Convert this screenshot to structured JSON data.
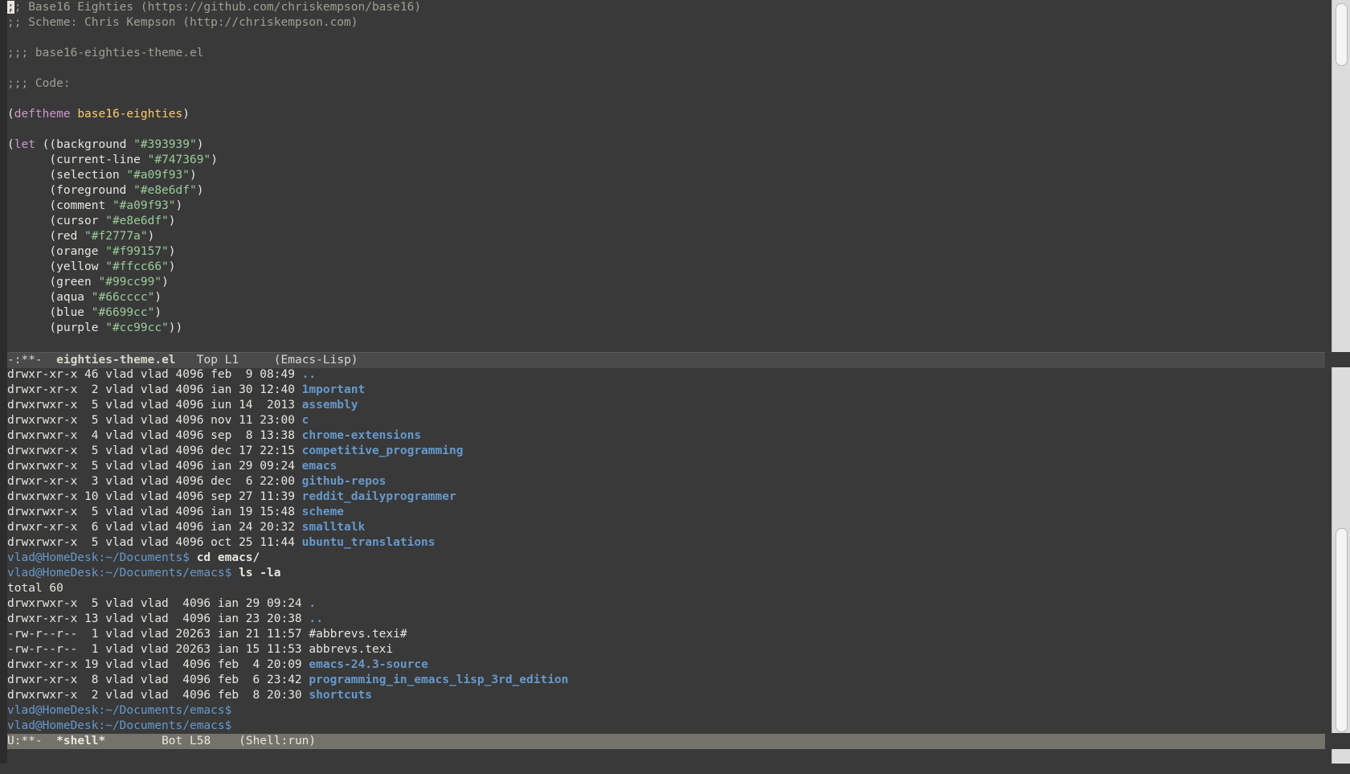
{
  "editor": {
    "lines": [
      [
        {
          "t": ";",
          "c": "cursor-block"
        },
        {
          "t": "; Base16 Eighties (https://github.com/chriskempson/base16)",
          "c": "cmt"
        }
      ],
      [
        {
          "t": ";; Scheme: Chris Kempson (http://chriskempson.com)",
          "c": "cmt"
        }
      ],
      [],
      [
        {
          "t": ";;; base16-eighties-theme.el",
          "c": "cmt"
        }
      ],
      [],
      [
        {
          "t": ";;; Code:",
          "c": "cmt"
        }
      ],
      [],
      [
        {
          "t": "(",
          "c": ""
        },
        {
          "t": "deftheme",
          "c": "kw"
        },
        {
          "t": " ",
          "c": ""
        },
        {
          "t": "base16-eighties",
          "c": "fn"
        },
        {
          "t": ")",
          "c": ""
        }
      ],
      [],
      [
        {
          "t": "(",
          "c": ""
        },
        {
          "t": "let",
          "c": "kw"
        },
        {
          "t": " ((background ",
          "c": ""
        },
        {
          "t": "\"#393939\"",
          "c": "str"
        },
        {
          "t": ")",
          "c": ""
        }
      ],
      [
        {
          "t": "      (current-line ",
          "c": ""
        },
        {
          "t": "\"#747369\"",
          "c": "str"
        },
        {
          "t": ")",
          "c": ""
        }
      ],
      [
        {
          "t": "      (selection ",
          "c": ""
        },
        {
          "t": "\"#a09f93\"",
          "c": "str"
        },
        {
          "t": ")",
          "c": ""
        }
      ],
      [
        {
          "t": "      (foreground ",
          "c": ""
        },
        {
          "t": "\"#e8e6df\"",
          "c": "str"
        },
        {
          "t": ")",
          "c": ""
        }
      ],
      [
        {
          "t": "      (comment ",
          "c": ""
        },
        {
          "t": "\"#a09f93\"",
          "c": "str"
        },
        {
          "t": ")",
          "c": ""
        }
      ],
      [
        {
          "t": "      (cursor ",
          "c": ""
        },
        {
          "t": "\"#e8e6df\"",
          "c": "str"
        },
        {
          "t": ")",
          "c": ""
        }
      ],
      [
        {
          "t": "      (red ",
          "c": ""
        },
        {
          "t": "\"#f2777a\"",
          "c": "str"
        },
        {
          "t": ")",
          "c": ""
        }
      ],
      [
        {
          "t": "      (orange ",
          "c": ""
        },
        {
          "t": "\"#f99157\"",
          "c": "str"
        },
        {
          "t": ")",
          "c": ""
        }
      ],
      [
        {
          "t": "      (yellow ",
          "c": ""
        },
        {
          "t": "\"#ffcc66\"",
          "c": "str"
        },
        {
          "t": ")",
          "c": ""
        }
      ],
      [
        {
          "t": "      (green ",
          "c": ""
        },
        {
          "t": "\"#99cc99\"",
          "c": "str"
        },
        {
          "t": ")",
          "c": ""
        }
      ],
      [
        {
          "t": "      (aqua ",
          "c": ""
        },
        {
          "t": "\"#66cccc\"",
          "c": "str"
        },
        {
          "t": ")",
          "c": ""
        }
      ],
      [
        {
          "t": "      (blue ",
          "c": ""
        },
        {
          "t": "\"#6699cc\"",
          "c": "str"
        },
        {
          "t": ")",
          "c": ""
        }
      ],
      [
        {
          "t": "      (purple ",
          "c": ""
        },
        {
          "t": "\"#cc99cc\"",
          "c": "str"
        },
        {
          "t": "))",
          "c": ""
        }
      ]
    ]
  },
  "modeline_top": {
    "state": "-:**-",
    "buffer": "eighties-theme.el",
    "position": "Top L1",
    "mode": "(Emacs-Lisp)"
  },
  "shell": {
    "lines": [
      [
        {
          "t": "drwxr-xr-x 46 vlad vlad 4096 feb  9 08:49 ",
          "c": ""
        },
        {
          "t": "..",
          "c": "dir"
        }
      ],
      [
        {
          "t": "drwxr-xr-x  2 vlad vlad 4096 ian 30 12:40 ",
          "c": ""
        },
        {
          "t": "1mportant",
          "c": "dir"
        }
      ],
      [
        {
          "t": "drwxrwxr-x  5 vlad vlad 4096 iun 14  2013 ",
          "c": ""
        },
        {
          "t": "assembly",
          "c": "dir"
        }
      ],
      [
        {
          "t": "drwxrwxr-x  5 vlad vlad 4096 nov 11 23:00 ",
          "c": ""
        },
        {
          "t": "c",
          "c": "dir"
        }
      ],
      [
        {
          "t": "drwxrwxr-x  4 vlad vlad 4096 sep  8 13:38 ",
          "c": ""
        },
        {
          "t": "chrome-extensions",
          "c": "dir"
        }
      ],
      [
        {
          "t": "drwxrwxr-x  5 vlad vlad 4096 dec 17 22:15 ",
          "c": ""
        },
        {
          "t": "competitive_programming",
          "c": "dir"
        }
      ],
      [
        {
          "t": "drwxrwxr-x  5 vlad vlad 4096 ian 29 09:24 ",
          "c": ""
        },
        {
          "t": "emacs",
          "c": "dir"
        }
      ],
      [
        {
          "t": "drwxr-xr-x  3 vlad vlad 4096 dec  6 22:00 ",
          "c": ""
        },
        {
          "t": "github-repos",
          "c": "dir"
        }
      ],
      [
        {
          "t": "drwxrwxr-x 10 vlad vlad 4096 sep 27 11:39 ",
          "c": ""
        },
        {
          "t": "reddit_dailyprogrammer",
          "c": "dir"
        }
      ],
      [
        {
          "t": "drwxrwxr-x  5 vlad vlad 4096 ian 19 15:48 ",
          "c": ""
        },
        {
          "t": "scheme",
          "c": "dir"
        }
      ],
      [
        {
          "t": "drwxr-xr-x  6 vlad vlad 4096 ian 24 20:32 ",
          "c": ""
        },
        {
          "t": "smalltalk",
          "c": "dir"
        }
      ],
      [
        {
          "t": "drwxrwxr-x  5 vlad vlad 4096 oct 25 11:44 ",
          "c": ""
        },
        {
          "t": "ubuntu_translations",
          "c": "dir"
        }
      ],
      [
        {
          "t": "vlad@HomeDesk:~/Documents$ ",
          "c": "prompt"
        },
        {
          "t": "cd emacs/",
          "c": "cmd"
        }
      ],
      [
        {
          "t": "vlad@HomeDesk:~/Documents/emacs$ ",
          "c": "prompt"
        },
        {
          "t": "ls -la",
          "c": "cmd"
        }
      ],
      [
        {
          "t": "total 60",
          "c": ""
        }
      ],
      [
        {
          "t": "drwxrwxr-x  5 vlad vlad  4096 ian 29 09:24 ",
          "c": ""
        },
        {
          "t": ".",
          "c": "dir"
        }
      ],
      [
        {
          "t": "drwxr-xr-x 13 vlad vlad  4096 ian 23 20:38 ",
          "c": ""
        },
        {
          "t": "..",
          "c": "dir"
        }
      ],
      [
        {
          "t": "-rw-r--r--  1 vlad vlad 20263 ian 21 11:57 #abbrevs.texi#",
          "c": ""
        }
      ],
      [
        {
          "t": "-rw-r--r--  1 vlad vlad 20263 ian 15 11:53 abbrevs.texi",
          "c": ""
        }
      ],
      [
        {
          "t": "drwxr-xr-x 19 vlad vlad  4096 feb  4 20:09 ",
          "c": ""
        },
        {
          "t": "emacs-24.3-source",
          "c": "dir"
        }
      ],
      [
        {
          "t": "drwxr-xr-x  8 vlad vlad  4096 feb  6 23:42 ",
          "c": ""
        },
        {
          "t": "programming_in_emacs_lisp_3rd_edition",
          "c": "dir"
        }
      ],
      [
        {
          "t": "drwxrwxr-x  2 vlad vlad  4096 feb  8 20:30 ",
          "c": ""
        },
        {
          "t": "shortcuts",
          "c": "dir"
        }
      ],
      [
        {
          "t": "vlad@HomeDesk:~/Documents/emacs$",
          "c": "prompt"
        }
      ],
      [
        {
          "t": "vlad@HomeDesk:~/Documents/emacs$",
          "c": "prompt"
        }
      ]
    ]
  },
  "modeline_bottom": {
    "state": "U:**-",
    "buffer": "*shell*",
    "position": "Bot L58",
    "mode": "(Shell:run)"
  }
}
